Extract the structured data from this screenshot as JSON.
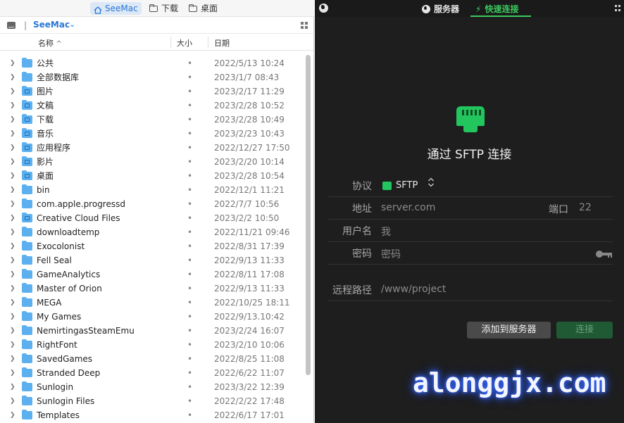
{
  "left_pane": {
    "tabs": [
      {
        "label": "SeeMac",
        "icon": "home-icon",
        "active": true
      },
      {
        "label": "下载",
        "icon": "folder-icon",
        "active": false
      },
      {
        "label": "桌面",
        "icon": "folder-icon",
        "active": false
      }
    ],
    "location": {
      "separator": "|",
      "name": "SeeMac",
      "chevron": "⌄"
    },
    "columns": {
      "name": "名称",
      "sort_indicator": "^",
      "size": "大小",
      "date": "日期"
    },
    "files": [
      {
        "name": "公共",
        "size": "•",
        "date": "2022/5/13 10:24",
        "badge": false
      },
      {
        "name": "全部数据库",
        "size": "•",
        "date": "2023/1/7 08:43",
        "badge": false
      },
      {
        "name": "图片",
        "size": "•",
        "date": "2023/2/17 11:29",
        "badge": true
      },
      {
        "name": "文稿",
        "size": "•",
        "date": "2023/2/28 10:52",
        "badge": true
      },
      {
        "name": "下载",
        "size": "•",
        "date": "2023/2/28 10:49",
        "badge": true
      },
      {
        "name": "音乐",
        "size": "•",
        "date": "2023/2/23 10:43",
        "badge": true
      },
      {
        "name": "应用程序",
        "size": "•",
        "date": "2022/12/27 17:50",
        "badge": true
      },
      {
        "name": "影片",
        "size": "•",
        "date": "2023/2/20 10:14",
        "badge": true
      },
      {
        "name": "桌面",
        "size": "•",
        "date": "2023/2/28 10:54",
        "badge": true
      },
      {
        "name": "bin",
        "size": "•",
        "date": "2022/12/1 11:21",
        "badge": false
      },
      {
        "name": "com.apple.progressd",
        "size": "•",
        "date": "2022/7/7 10:56",
        "badge": false
      },
      {
        "name": "Creative Cloud Files",
        "size": "•",
        "date": "2023/2/2 10:50",
        "badge": true
      },
      {
        "name": "downloadtemp",
        "size": "•",
        "date": "2022/11/21 09:46",
        "badge": false
      },
      {
        "name": "Exocolonist",
        "size": "•",
        "date": "2022/8/31 17:39",
        "badge": false
      },
      {
        "name": "Fell Seal",
        "size": "•",
        "date": "2022/9/13 11:33",
        "badge": false
      },
      {
        "name": "GameAnalytics",
        "size": "•",
        "date": "2022/8/11 17:08",
        "badge": false
      },
      {
        "name": "Master of Orion",
        "size": "•",
        "date": "2022/9/13 11:33",
        "badge": false
      },
      {
        "name": "MEGA",
        "size": "•",
        "date": "2022/10/25 18:11",
        "badge": false
      },
      {
        "name": "My Games",
        "size": "•",
        "date": "2022/9/13.10:42",
        "badge": false
      },
      {
        "name": "NemirtingasSteamEmu",
        "size": "•",
        "date": "2023/2/24 16:07",
        "badge": false
      },
      {
        "name": "RightFont",
        "size": "•",
        "date": "2023/2/10 10:06",
        "badge": false
      },
      {
        "name": "SavedGames",
        "size": "•",
        "date": "2022/8/25 11:08",
        "badge": false
      },
      {
        "name": "Stranded Deep",
        "size": "•",
        "date": "2022/6/22 11:07",
        "badge": false
      },
      {
        "name": "Sunlogin",
        "size": "•",
        "date": "2023/3/22 12:39",
        "badge": false
      },
      {
        "name": "Sunlogin Files",
        "size": "•",
        "date": "2022/2/22 17:48",
        "badge": false
      },
      {
        "name": "Templates",
        "size": "•",
        "date": "2022/6/17 17:01",
        "badge": false
      }
    ]
  },
  "right_pane": {
    "tabs": {
      "servers": "服务器",
      "quick_connect": "快速连接",
      "quick_icon": "⚡"
    },
    "title": "通过 SFTP 连接",
    "form": {
      "protocol_label": "协议",
      "protocol_value": "SFTP",
      "protocol_arrows": "⌃⌄",
      "address_label": "地址",
      "address_placeholder": "server.com",
      "port_label": "端口",
      "port_placeholder": "22",
      "username_label": "用户名",
      "username_placeholder": "我",
      "password_label": "密码",
      "password_placeholder": "密码",
      "remote_path_label": "远程路径",
      "remote_path_placeholder": "/www/project"
    },
    "buttons": {
      "add_to_servers": "添加到服务器",
      "connect": "连接"
    },
    "watermark": "alonggjx.com",
    "colors": {
      "accent": "#3ccb5e",
      "background": "#1e1e1e",
      "connect_bg": "#1f5a34"
    }
  }
}
